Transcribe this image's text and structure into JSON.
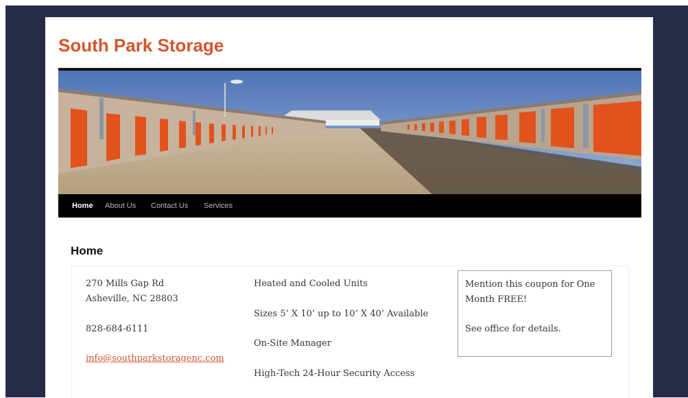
{
  "site": {
    "title": "South Park Storage"
  },
  "banner": {
    "image": "storage-units-banner"
  },
  "nav": {
    "items": [
      {
        "label": "Home"
      },
      {
        "label": "About Us"
      },
      {
        "label": "Contact Us"
      },
      {
        "label": "Services"
      }
    ]
  },
  "page": {
    "heading": "Home"
  },
  "contact": {
    "address_line1": "270 Mills Gap Rd",
    "address_line2": "Asheville, NC 28803",
    "phone": "828-684-6111",
    "email": "info@southparkstoragenc.com"
  },
  "features": [
    "Heated and Cooled Units",
    "Sizes 5’ X 10’ up to 10’ X 40’ Available",
    "On-Site Manager",
    "High-Tech 24-Hour Security Access"
  ],
  "coupon": {
    "line1": "Mention this coupon for One",
    "line2": "Month FREE!",
    "details": "See office for details."
  },
  "colors": {
    "accent": "#d0562e",
    "frame": "#262b48",
    "nav_bg": "#000000"
  }
}
